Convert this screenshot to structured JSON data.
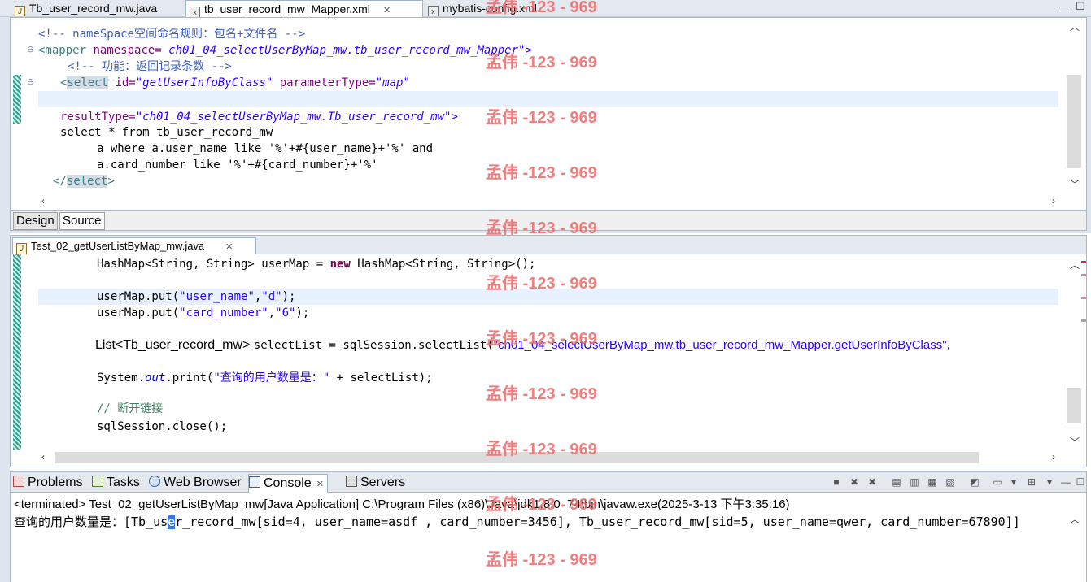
{
  "top_tabs": [
    {
      "label": "Tb_user_record_mw.java"
    },
    {
      "label": "tb_user_record_mw_Mapper.xml"
    },
    {
      "label": "mybatis-config.xml"
    }
  ],
  "xml_editor": {
    "lines": [
      {
        "comment": "<!-- nameSpace空间命名规则：包名+文件名 -->"
      },
      {
        "open": "<mapper ",
        "attr": "namespace=",
        "value": " ch01_04_selectUserByMap_mw.tb_user_record_mw_Mapper\">"
      },
      {
        "comment": "<!-- 功能：返回记录条数 -->"
      },
      {
        "lt": "<",
        "tag": "select",
        "attr1": " id=",
        "value1": "\"getUserInfoByClass\"",
        "attr2": " parameterType=",
        "value2": "\"map\""
      },
      {
        "blank": ""
      },
      {
        "attr": "resultType=",
        "value": "\"ch01_04_selectUserByMap_mw.Tb_user_record_mw\">"
      },
      {
        "text": "select * from tb_user_record_mw"
      },
      {
        "text": "a where a.user_name like '%'+#{user_name}+'%' and"
      },
      {
        "text": "a.card_number like '%'+#{card_number}+'%'"
      },
      {
        "lt": "</",
        "tag": "select",
        "gt": ">"
      }
    ],
    "design_tab": "Design",
    "source_tab": "Source"
  },
  "java_editor": {
    "tab": "Test_02_getUserListByMap_mw.java",
    "line1": "HashMap<String, String> userMap = ",
    "line1_kw": "new",
    "line1_rest": " HashMap<String, String>();",
    "put1_a": "userMap.put(",
    "put1_k": "\"user_name\"",
    "put1_c": ",",
    "put1_v": "\"d\"",
    "put1_e": ");",
    "put2_a": "userMap.put(",
    "put2_k": "\"card_number\"",
    "put2_c": ",",
    "put2_v": "\"6\"",
    "put2_e": ");",
    "list_a": "List<Tb_user_record_mw> ",
    "list_b": "selectList = sqlSession.selectList(",
    "list_s": "\"ch01_04_selectUserByMap_mw.tb_user_record_mw_Mapper.getUserInfoByClass\",",
    "print_a": "System.",
    "print_f": "out",
    "print_b": ".print(",
    "print_s": "\"查询的用户数量是：\"",
    "print_e": " + selectList);",
    "comment": "// 断开链接",
    "close": "sqlSession.close();"
  },
  "console": {
    "tabs": [
      {
        "label": "Problems"
      },
      {
        "label": "Tasks"
      },
      {
        "label": "Web Browser"
      },
      {
        "label": "Console"
      },
      {
        "label": "Servers"
      }
    ],
    "status": "<terminated> Test_02_getUserListByMap_mw[Java Application] C:\\Program Files (x86)\\Java\\jdk1.8.0_74\\bin\\javaw.exe(2025-3-13 下午3:35:16)",
    "out_a": "查询的用户数量是：[Tb_us",
    "out_caret": "e",
    "out_b": "r_record_mw[sid=4, user_name=asdf , card_number=3456], Tb_user_record_mw[sid=5, user_name=qwer, card_number=67890]]"
  },
  "watermark": "孟伟 -123 - 969",
  "colors": {
    "comment": "#3f5fbf",
    "tag": "#3f7f7f",
    "attr": "#7f007f",
    "string": "#2a00ff",
    "keyword": "#7f0055",
    "watermark": "#ee6a6a"
  }
}
